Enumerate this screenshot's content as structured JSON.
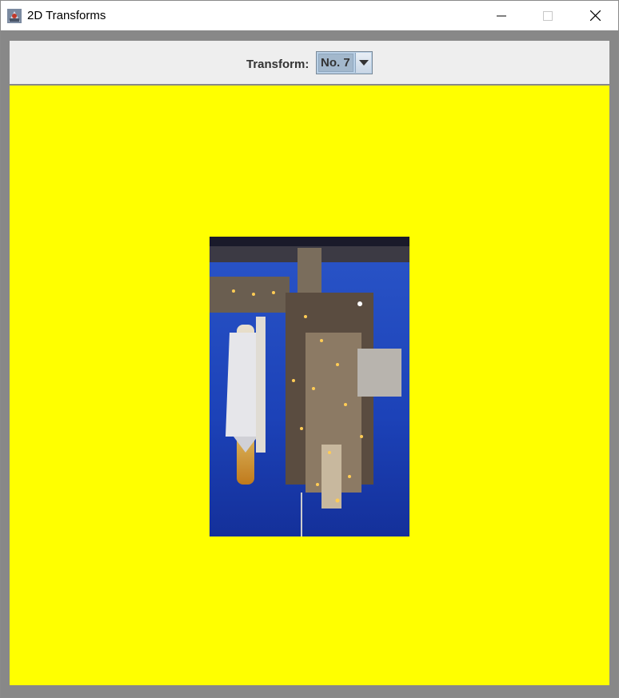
{
  "window": {
    "title": "2D Transforms",
    "controls": {
      "minimize_icon": "minimize-icon",
      "maximize_icon": "maximize-icon",
      "close_icon": "close-icon"
    }
  },
  "toolbar": {
    "transform_label": "Transform:",
    "transform_selected": "No. 7"
  },
  "canvas": {
    "background_color": "#ffff00",
    "image_description_icon": "space-shuttle-launchpad-image"
  }
}
